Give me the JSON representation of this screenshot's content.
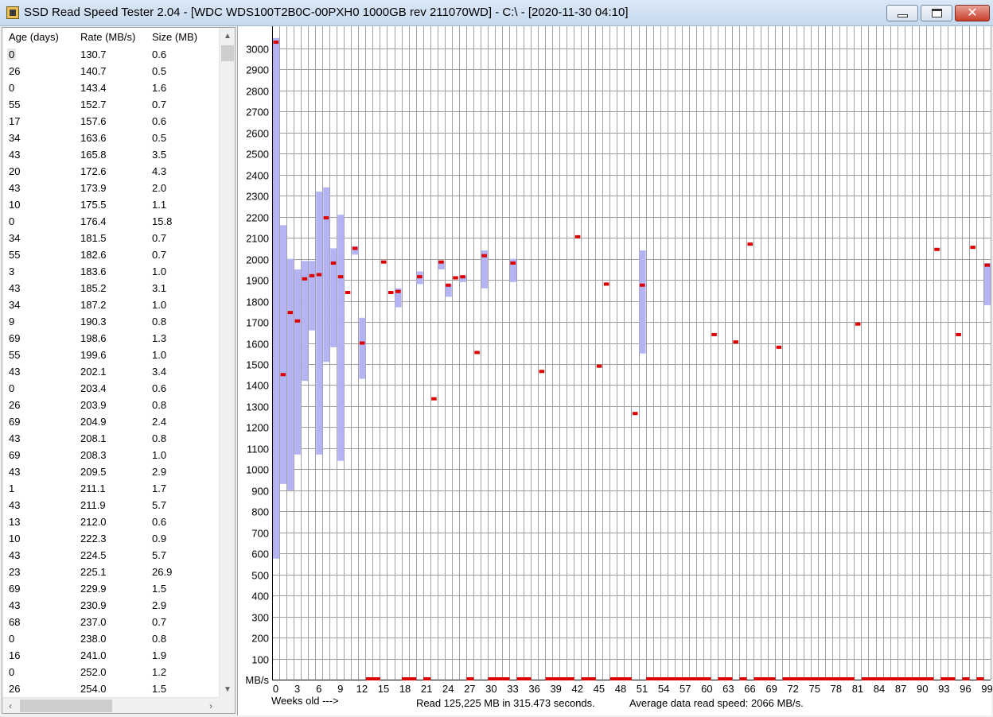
{
  "window": {
    "title": "SSD Read Speed Tester 2.04 - [WDC WDS100T2B0C-00PXH0 1000GB rev 211070WD] - C:\\ - [2020-11-30 04:10]",
    "icon": "drive-icon",
    "controls": {
      "minimize": "minimize-icon",
      "maximize": "maximize-icon",
      "close": "✕"
    }
  },
  "list": {
    "columns": [
      "Age (days)",
      "Rate (MB/s)",
      "Size (MB)"
    ],
    "rows": [
      [
        "0",
        "130.7",
        "0.6"
      ],
      [
        "26",
        "140.7",
        "0.5"
      ],
      [
        "0",
        "143.4",
        "1.6"
      ],
      [
        "55",
        "152.7",
        "0.7"
      ],
      [
        "17",
        "157.6",
        "0.6"
      ],
      [
        "34",
        "163.6",
        "0.5"
      ],
      [
        "43",
        "165.8",
        "3.5"
      ],
      [
        "20",
        "172.6",
        "4.3"
      ],
      [
        "43",
        "173.9",
        "2.0"
      ],
      [
        "10",
        "175.5",
        "1.1"
      ],
      [
        "0",
        "176.4",
        "15.8"
      ],
      [
        "34",
        "181.5",
        "0.7"
      ],
      [
        "55",
        "182.6",
        "0.7"
      ],
      [
        "3",
        "183.6",
        "1.0"
      ],
      [
        "43",
        "185.2",
        "3.1"
      ],
      [
        "34",
        "187.2",
        "1.0"
      ],
      [
        "9",
        "190.3",
        "0.8"
      ],
      [
        "69",
        "198.6",
        "1.3"
      ],
      [
        "55",
        "199.6",
        "1.0"
      ],
      [
        "43",
        "202.1",
        "3.4"
      ],
      [
        "0",
        "203.4",
        "0.6"
      ],
      [
        "26",
        "203.9",
        "0.8"
      ],
      [
        "69",
        "204.9",
        "2.4"
      ],
      [
        "43",
        "208.1",
        "0.8"
      ],
      [
        "69",
        "208.3",
        "1.0"
      ],
      [
        "43",
        "209.5",
        "2.9"
      ],
      [
        "1",
        "211.1",
        "1.7"
      ],
      [
        "43",
        "211.9",
        "5.7"
      ],
      [
        "13",
        "212.0",
        "0.6"
      ],
      [
        "10",
        "222.3",
        "0.9"
      ],
      [
        "43",
        "224.5",
        "5.7"
      ],
      [
        "23",
        "225.1",
        "26.9"
      ],
      [
        "69",
        "229.9",
        "1.5"
      ],
      [
        "43",
        "230.9",
        "2.9"
      ],
      [
        "68",
        "237.0",
        "0.7"
      ],
      [
        "0",
        "238.0",
        "0.8"
      ],
      [
        "16",
        "241.0",
        "1.9"
      ],
      [
        "0",
        "252.0",
        "1.2"
      ],
      [
        "26",
        "254.0",
        "1.5"
      ]
    ],
    "selected_row": 0
  },
  "status": {
    "weeks_label": "Weeks old --->",
    "read_summary": "Read 125,225 MB in 315.473 seconds.",
    "average": "Average data read speed: 2066 MB/s."
  },
  "chart_data": {
    "type": "bar",
    "ylabel": "MB/s",
    "xlabel": "Weeks old --->",
    "ylim": [
      0,
      3100
    ],
    "yticks": [
      100,
      200,
      300,
      400,
      500,
      600,
      700,
      800,
      900,
      1000,
      1100,
      1200,
      1300,
      1400,
      1500,
      1600,
      1700,
      1800,
      1900,
      2000,
      2100,
      2200,
      2300,
      2400,
      2500,
      2600,
      2700,
      2800,
      2900,
      3000
    ],
    "xticks": [
      "0",
      "3",
      "6",
      "9",
      "12",
      "15",
      "18",
      "21",
      "24",
      "27",
      "30",
      "33",
      "36",
      "39",
      "42",
      "45",
      "48",
      "51",
      "54",
      "57",
      "60",
      "63",
      "66",
      "69",
      "72",
      "75",
      "78",
      "81",
      "84",
      "87",
      "90",
      "93",
      "96",
      "99"
    ],
    "xmax": 100,
    "grid": true,
    "colors": {
      "range": "#b4b4f5",
      "average": "#dc0000",
      "grid": "#a0a0a0"
    },
    "series": [
      {
        "name": "min-max range",
        "ranges": [
          [
            0,
            575,
            3050
          ],
          [
            1,
            930,
            2160
          ],
          [
            2,
            900,
            2000
          ],
          [
            3,
            1070,
            1950
          ],
          [
            4,
            1420,
            1990
          ],
          [
            5,
            1660,
            1990
          ],
          [
            6,
            1070,
            2320
          ],
          [
            7,
            1510,
            2340
          ],
          [
            8,
            1580,
            2050
          ],
          [
            9,
            1040,
            2210
          ],
          [
            12,
            1430,
            1720
          ],
          [
            11,
            2020,
            2060
          ],
          [
            17,
            1770,
            1860
          ],
          [
            20,
            1880,
            1940
          ],
          [
            23,
            1950,
            1990
          ],
          [
            24,
            1820,
            1880
          ],
          [
            26,
            1890,
            1920
          ],
          [
            29,
            1860,
            2040
          ],
          [
            33,
            1890,
            2000
          ],
          [
            51,
            1550,
            2040
          ],
          [
            99,
            1780,
            1980
          ]
        ]
      },
      {
        "name": "average",
        "values": [
          [
            0,
            3030
          ],
          [
            1,
            1450
          ],
          [
            2,
            1745
          ],
          [
            3,
            1705
          ],
          [
            4,
            1905
          ],
          [
            5,
            1920
          ],
          [
            6,
            1925
          ],
          [
            7,
            2195
          ],
          [
            8,
            1980
          ],
          [
            9,
            1915
          ],
          [
            10,
            1840
          ],
          [
            11,
            2050
          ],
          [
            12,
            1600
          ],
          [
            15,
            1985
          ],
          [
            16,
            1840
          ],
          [
            17,
            1845
          ],
          [
            20,
            1915
          ],
          [
            22,
            1335
          ],
          [
            23,
            1985
          ],
          [
            24,
            1875
          ],
          [
            25,
            1910
          ],
          [
            26,
            1915
          ],
          [
            28,
            1555
          ],
          [
            29,
            2015
          ],
          [
            33,
            1980
          ],
          [
            37,
            1465
          ],
          [
            42,
            2105
          ],
          [
            45,
            1490
          ],
          [
            46,
            1880
          ],
          [
            50,
            1265
          ],
          [
            51,
            1875
          ],
          [
            61,
            1640
          ],
          [
            64,
            1605
          ],
          [
            66,
            2070
          ],
          [
            70,
            1580
          ],
          [
            81,
            1690
          ],
          [
            92,
            2045
          ],
          [
            95,
            1640
          ],
          [
            97,
            2055
          ],
          [
            99,
            1970
          ]
        ]
      },
      {
        "name": "zero-weeks",
        "weeks": [
          13,
          14,
          18,
          19,
          21,
          27,
          30,
          31,
          32,
          34,
          35,
          38,
          39,
          40,
          41,
          43,
          44,
          47,
          48,
          49,
          52,
          53,
          54,
          55,
          56,
          57,
          58,
          59,
          60,
          62,
          63,
          65,
          67,
          68,
          69,
          71,
          72,
          73,
          74,
          75,
          76,
          77,
          78,
          79,
          80,
          82,
          83,
          84,
          85,
          86,
          87,
          88,
          89,
          90,
          91,
          93,
          94,
          96,
          98
        ]
      }
    ]
  }
}
